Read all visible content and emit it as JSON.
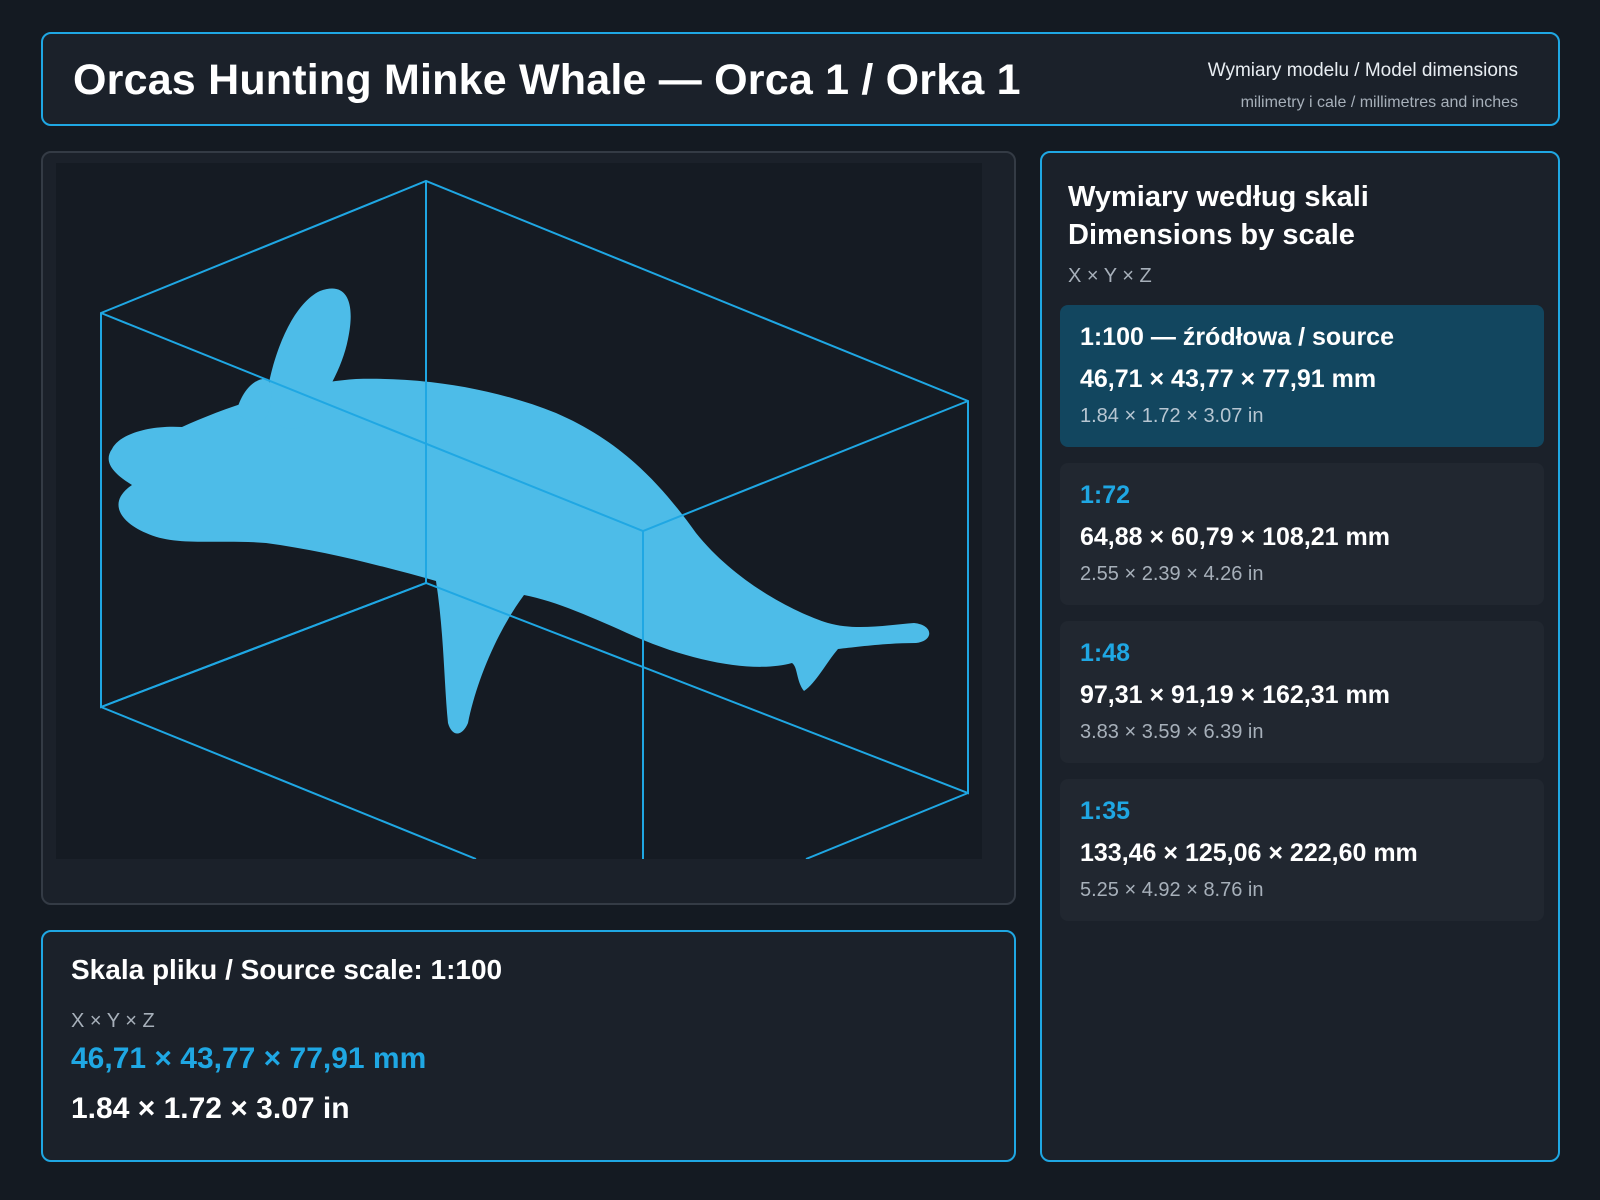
{
  "header": {
    "title": "Orcas Hunting Minke Whale — Orca 1 / Orka 1",
    "subtitle": "Wymiary modelu / Model dimensions",
    "units_note": "milimetry i cale / millimetres and inches"
  },
  "viewer": {
    "model_icon": "orca-model",
    "colors": {
      "model": "#4dbce8",
      "bbox": "#1fa7e3",
      "background": "#151b23"
    }
  },
  "summary": {
    "title": "Skala pliku / Source scale: 1:100",
    "axes": "X × Y × Z",
    "mm": "46,71 × 43,77 × 77,91 mm",
    "in": "1.84 × 1.72 × 3.07 in"
  },
  "sidebar": {
    "title_pl": "Wymiary według skali",
    "title_en": "Dimensions by scale",
    "axes": "X × Y × Z",
    "scales": [
      {
        "label": "1:100  —  źródłowa / source",
        "mm": "46,71 × 43,77 × 77,91 mm",
        "in": "1.84 × 1.72 × 3.07 in",
        "active": true
      },
      {
        "label": "1:72",
        "mm": "64,88 × 60,79 × 108,21 mm",
        "in": "2.55 × 2.39 × 4.26 in",
        "active": false
      },
      {
        "label": "1:48",
        "mm": "97,31 × 91,19 × 162,31 mm",
        "in": "3.83 × 3.59 × 6.39 in",
        "active": false
      },
      {
        "label": "1:35",
        "mm": "133,46 × 125,06 × 222,60 mm",
        "in": "5.25 × 4.92 × 8.76 in",
        "active": false
      }
    ]
  },
  "colors": {
    "accent": "#1fa7e3",
    "background": "#141a22",
    "panel": "#1b212a",
    "active_card": "#12465f"
  }
}
